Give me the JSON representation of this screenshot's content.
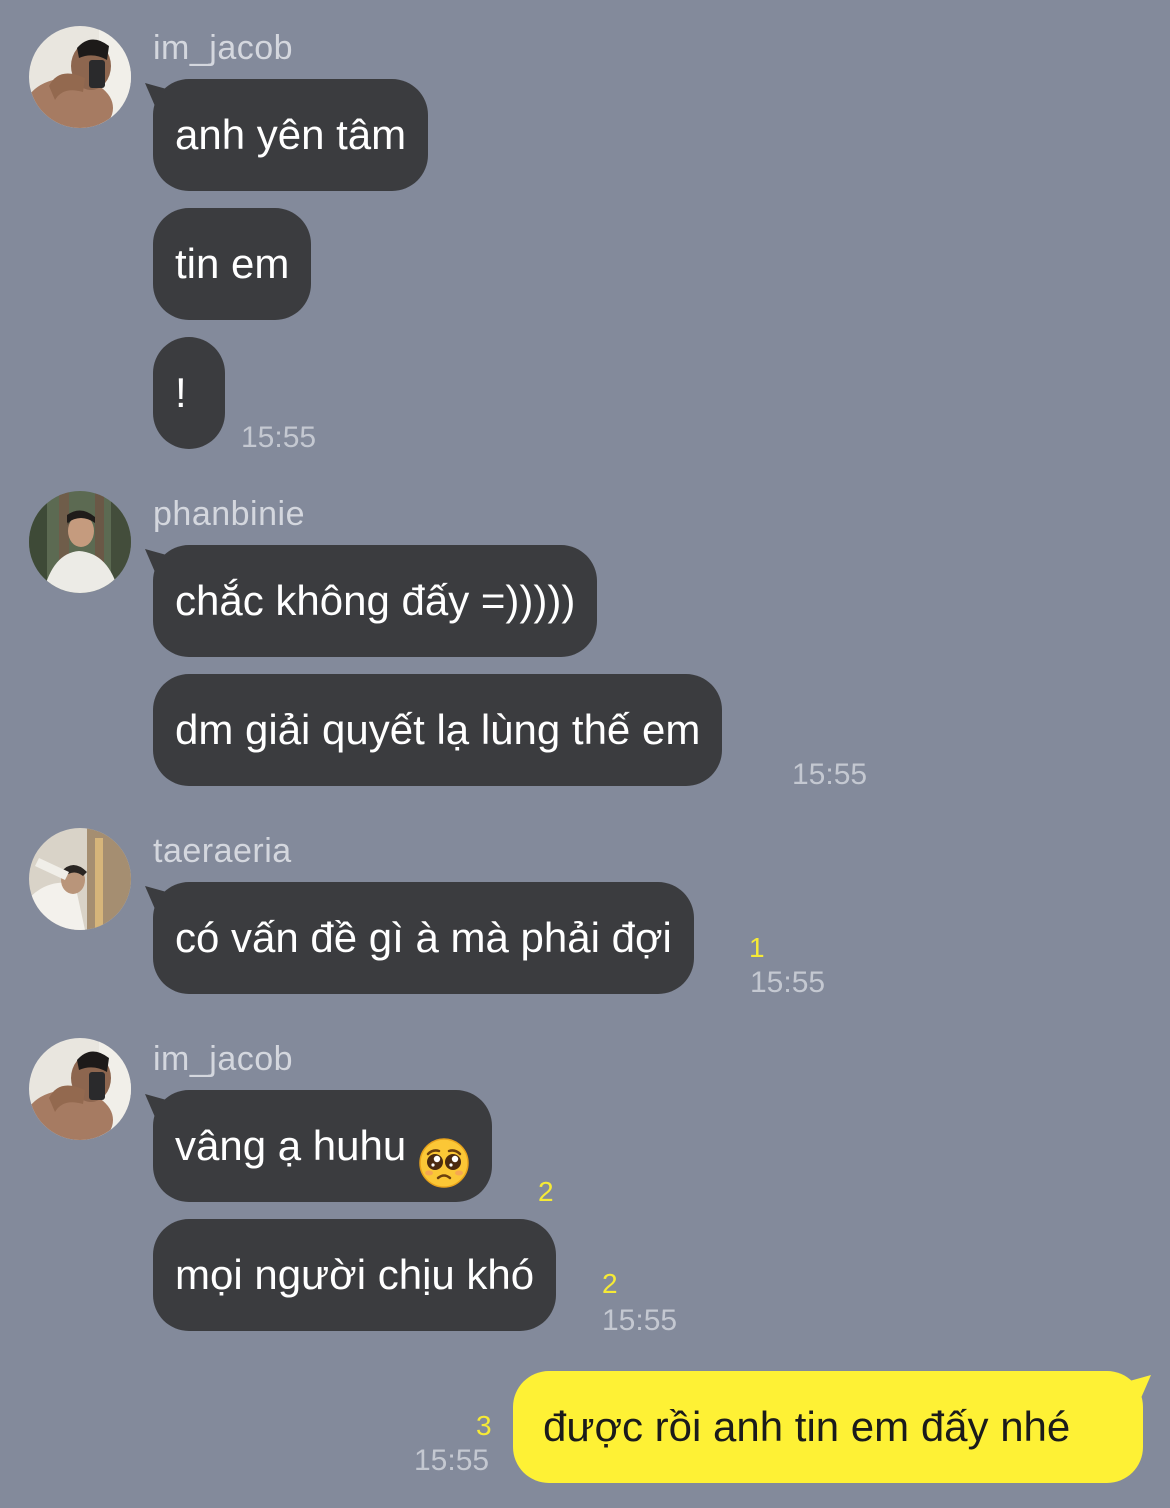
{
  "colors": {
    "background": "#838a9b",
    "incoming_bubble": "#3b3c3f",
    "outgoing_bubble": "#fef135",
    "unread_count": "#f6ea36"
  },
  "groups": [
    {
      "sender": "im_jacob",
      "avatar": "avatar-photo",
      "messages": [
        {
          "text": "anh yên tâm"
        },
        {
          "text": "tin em"
        },
        {
          "text": "!"
        }
      ],
      "time": "15:55"
    },
    {
      "sender": "phanbinie",
      "avatar": "avatar-photo",
      "messages": [
        {
          "text": "chắc không đấy =)))))"
        },
        {
          "text": "dm giải quyết lạ lùng thế em"
        }
      ],
      "time": "15:55"
    },
    {
      "sender": "taeraeria",
      "avatar": "avatar-photo",
      "messages": [
        {
          "text": "có vấn đề gì à mà phải đợi",
          "unread": "1"
        }
      ],
      "time": "15:55"
    },
    {
      "sender": "im_jacob",
      "avatar": "avatar-photo",
      "messages": [
        {
          "text": "vâng ạ huhu",
          "emoji": "pleading-face-emoji",
          "unread": "2"
        },
        {
          "text": "mọi người chịu khó",
          "unread": "2"
        }
      ],
      "time": "15:55"
    }
  ],
  "outgoing": {
    "text": "được rồi anh tin em đấy nhé",
    "unread": "3",
    "time": "15:55"
  }
}
